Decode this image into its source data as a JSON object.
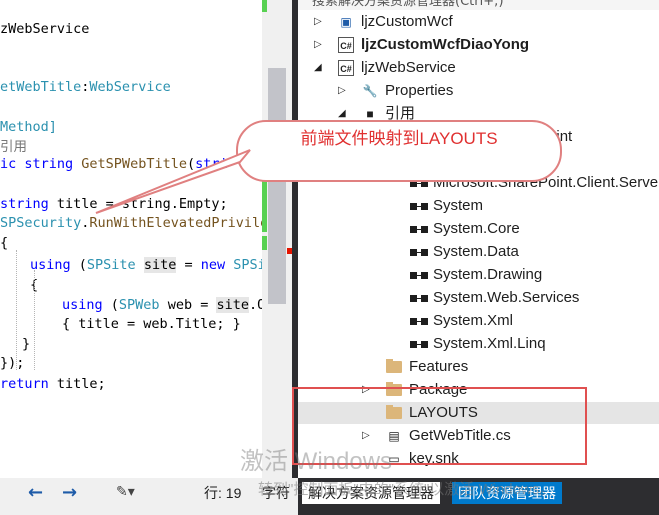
{
  "editor": {
    "lines": [
      {
        "parts": [
          {
            "t": "zWebService",
            "c": ""
          }
        ]
      },
      {
        "parts": [
          {
            "t": "etWebTitle",
            "c": "ty"
          },
          {
            "t": ":",
            "c": ""
          },
          {
            "t": "WebService",
            "c": "ty"
          }
        ]
      },
      {
        "parts": [
          {
            "t": "Method]",
            "c": "ty"
          }
        ]
      },
      {
        "parts": [
          {
            "t": "引用",
            "c": "cm"
          }
        ]
      },
      {
        "parts": [
          {
            "t": "ic ",
            "c": "kw"
          },
          {
            "t": "string ",
            "c": "kw"
          },
          {
            "t": "GetSPWebTitle",
            "c": "mt"
          },
          {
            "t": "(",
            "c": ""
          },
          {
            "t": "stri",
            "c": "kw"
          }
        ]
      },
      {
        "parts": [
          {
            "t": "string ",
            "c": "kw"
          },
          {
            "t": "title = string.Empty;",
            "c": ""
          }
        ]
      },
      {
        "parts": [
          {
            "t": "SPSecurity",
            "c": "ty"
          },
          {
            "t": ".",
            "c": ""
          },
          {
            "t": "RunWithElevatedPrivile",
            "c": "mt"
          }
        ]
      },
      {
        "parts": [
          {
            "t": "{",
            "c": ""
          }
        ]
      },
      {
        "parts": [
          {
            "t": "using ",
            "c": "kw"
          },
          {
            "t": "(",
            "c": ""
          },
          {
            "t": "SPSite ",
            "c": "ty"
          },
          {
            "t": "site",
            "c": "hl"
          },
          {
            "t": " = ",
            "c": ""
          },
          {
            "t": "new ",
            "c": "kw"
          },
          {
            "t": "SPSi",
            "c": "ty"
          }
        ]
      },
      {
        "parts": [
          {
            "t": "{",
            "c": ""
          }
        ]
      },
      {
        "parts": [
          {
            "t": "using ",
            "c": "kw"
          },
          {
            "t": "(",
            "c": ""
          },
          {
            "t": "SPWeb ",
            "c": "ty"
          },
          {
            "t": "web = ",
            "c": ""
          },
          {
            "t": "site",
            "c": "hl"
          },
          {
            "t": ".O",
            "c": ""
          }
        ]
      },
      {
        "parts": [
          {
            "t": "{ title = web.Title; }",
            "c": ""
          }
        ]
      },
      {
        "parts": [
          {
            "t": "}",
            "c": ""
          }
        ]
      },
      {
        "parts": [
          {
            "t": "});",
            "c": ""
          }
        ]
      },
      {
        "parts": [
          {
            "t": "return ",
            "c": "kw"
          },
          {
            "t": "title;",
            "c": ""
          }
        ]
      }
    ]
  },
  "solution_explorer": {
    "search_placeholder": "搜索解决方案资源管理器(Ctrl+;)",
    "items": [
      {
        "label": "ljzCustomWcf",
        "icon": "project-icon",
        "arrow": "collapsed",
        "bold": false
      },
      {
        "label": "ljzCustomWcfDiaoYong",
        "icon": "csharp-project-icon",
        "arrow": "collapsed",
        "bold": true
      },
      {
        "label": "ljzWebService",
        "icon": "csharp-project-icon",
        "arrow": "expanded",
        "bold": false
      },
      {
        "label": "Properties",
        "icon": "wrench-icon",
        "arrow": "collapsed",
        "bold": false
      },
      {
        "label": "引用",
        "icon": "references-icon",
        "arrow": "expanded",
        "bold": false
      },
      {
        "label": "Microsoft.SharePoint",
        "icon": "reference-icon",
        "arrow": "none",
        "bold": false
      },
      {
        "label": "Microsoft.SharePoint.Client.Server",
        "icon": "reference-icon",
        "arrow": "none",
        "bold": false
      },
      {
        "label": "System",
        "icon": "reference-icon",
        "arrow": "none",
        "bold": false
      },
      {
        "label": "System.Core",
        "icon": "reference-icon",
        "arrow": "none",
        "bold": false
      },
      {
        "label": "System.Data",
        "icon": "reference-icon",
        "arrow": "none",
        "bold": false
      },
      {
        "label": "System.Drawing",
        "icon": "reference-icon",
        "arrow": "none",
        "bold": false
      },
      {
        "label": "System.Web.Services",
        "icon": "reference-icon",
        "arrow": "none",
        "bold": false
      },
      {
        "label": "System.Xml",
        "icon": "reference-icon",
        "arrow": "none",
        "bold": false
      },
      {
        "label": "System.Xml.Linq",
        "icon": "reference-icon",
        "arrow": "none",
        "bold": false
      },
      {
        "label": "Features",
        "icon": "folder-icon",
        "arrow": "none",
        "bold": false
      },
      {
        "label": "Package",
        "icon": "folder-icon",
        "arrow": "collapsed",
        "bold": false
      },
      {
        "label": "LAYOUTS",
        "icon": "folder-icon",
        "arrow": "none",
        "bold": false
      },
      {
        "label": "GetWebTitle.cs",
        "icon": "cs-file-icon",
        "arrow": "collapsed",
        "bold": false
      },
      {
        "label": "key.snk",
        "icon": "key-file-icon",
        "arrow": "none",
        "bold": false
      }
    ]
  },
  "callout": {
    "text": "前端文件映射到LAYOUTS"
  },
  "watermark": {
    "line1": "激活 Windows",
    "line2": "转到\"控制面板\"中的\"系统\"以激活 Windows。"
  },
  "status": {
    "line": "行: 19",
    "col": "字符"
  },
  "bottom_tabs": {
    "solution_explorer": "解决方案资源管理器",
    "team_explorer": "团队资源管理器"
  },
  "colors": {
    "accent": "#007acc",
    "annotation": "#e05050"
  }
}
